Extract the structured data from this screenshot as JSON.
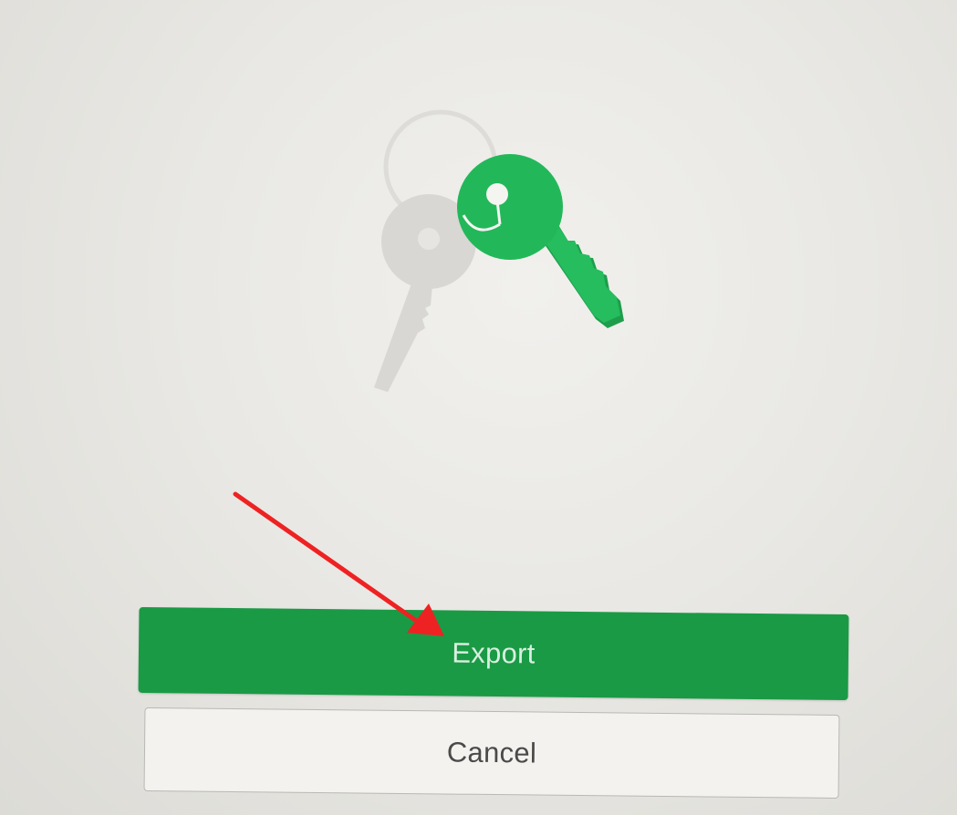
{
  "illustration": {
    "icon_name": "keys-icon",
    "primary_key_color": "#22b85a",
    "secondary_key_color": "#d6d5d2"
  },
  "actions": {
    "export_label": "Export",
    "cancel_label": "Cancel"
  },
  "annotation": {
    "arrow_color": "#ee2222"
  },
  "colors": {
    "accent": "#1a9a45",
    "background": "#e9e8e4"
  }
}
